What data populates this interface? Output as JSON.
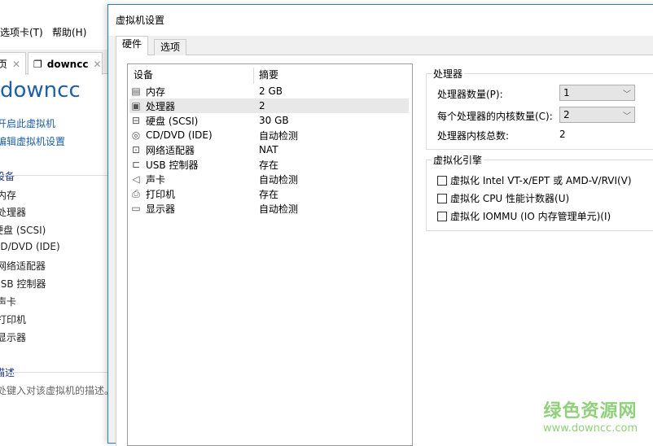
{
  "background_app": {
    "menu": [
      "选项卡(T)",
      "帮助(H)"
    ],
    "tabs": [
      {
        "label": "页"
      },
      {
        "label": "downcc"
      }
    ],
    "vm_title": "downcc",
    "actions": [
      "开启此虚拟机",
      "编辑虚拟机设置"
    ],
    "devices_section": "设备",
    "devices": [
      "内存",
      "处理器",
      "硬盘 (SCSI)",
      "CD/DVD (IDE)",
      "网络适配器",
      "USB 控制器",
      "声卡",
      "打印机",
      "显示器"
    ],
    "description_section": "描述",
    "description_placeholder": "处键入对该虚拟机的描述。"
  },
  "dialog": {
    "title": "虚拟机设置",
    "tabs": [
      {
        "label": "硬件",
        "active": true
      },
      {
        "label": "选项",
        "active": false
      }
    ],
    "device_table": {
      "headers": [
        "设备",
        "摘要"
      ],
      "rows": [
        {
          "icon": "memory-icon",
          "name": "内存",
          "summary": "2 GB"
        },
        {
          "icon": "processor-icon",
          "name": "处理器",
          "summary": "2",
          "selected": true
        },
        {
          "icon": "hard-disk-icon",
          "name": "硬盘 (SCSI)",
          "summary": "30 GB"
        },
        {
          "icon": "cd-dvd-icon",
          "name": "CD/DVD (IDE)",
          "summary": "自动检测"
        },
        {
          "icon": "network-adapter-icon",
          "name": "网络适配器",
          "summary": "NAT"
        },
        {
          "icon": "usb-icon",
          "name": "USB 控制器",
          "summary": "存在"
        },
        {
          "icon": "sound-card-icon",
          "name": "声卡",
          "summary": "自动检测"
        },
        {
          "icon": "printer-icon",
          "name": "打印机",
          "summary": "存在"
        },
        {
          "icon": "display-icon",
          "name": "显示器",
          "summary": "自动检测"
        }
      ]
    },
    "processor": {
      "group_label": "处理器",
      "count_label": "处理器数量(P):",
      "count_value": "1",
      "cores_label": "每个处理器的内核数量(C):",
      "cores_value": "2",
      "total_label": "处理器内核总数:",
      "total_value": "2"
    },
    "virtualization": {
      "group_label": "虚拟化引擎",
      "options": [
        {
          "label": "虚拟化 Intel VT-x/EPT 或 AMD-V/RVI(V)",
          "checked": false
        },
        {
          "label": "虚拟化 CPU 性能计数器(U)",
          "checked": false
        },
        {
          "label": "虚拟化 IOMMU (IO 内存管理单元)(I)",
          "checked": false
        }
      ]
    }
  },
  "watermark": {
    "name": "绿色资源网",
    "url": "www.downcc.com"
  }
}
